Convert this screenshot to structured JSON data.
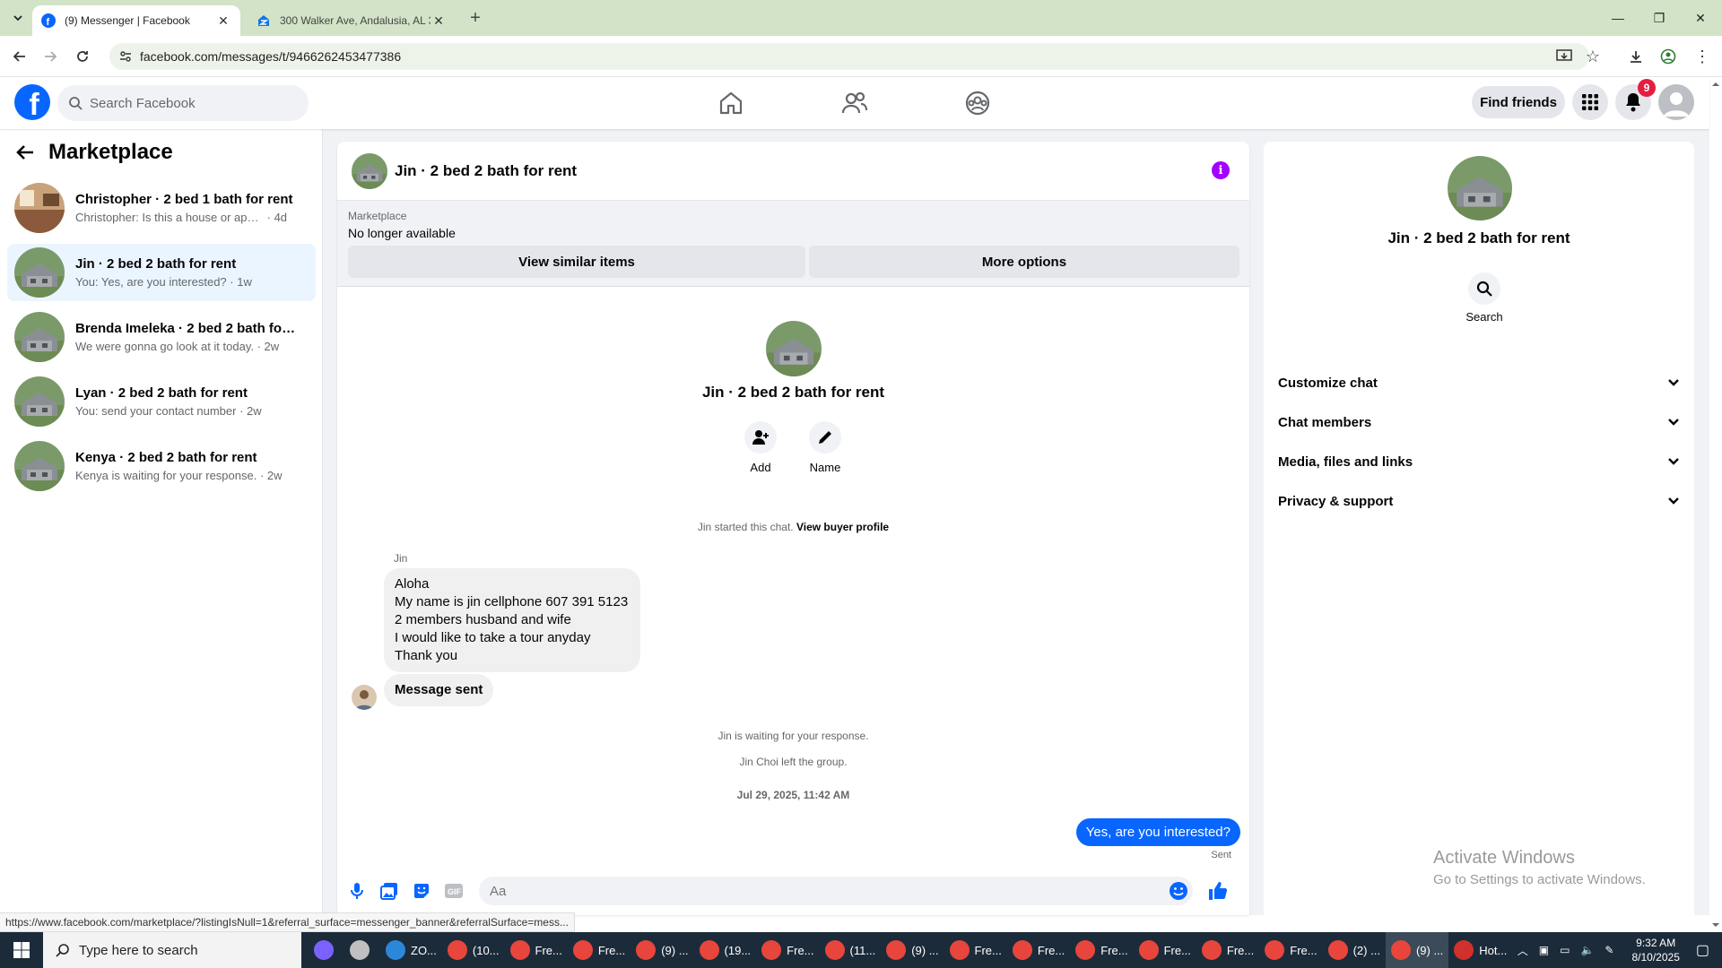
{
  "browser": {
    "tabs": [
      {
        "title": "(9) Messenger | Facebook",
        "active": true
      },
      {
        "title": "300 Walker Ave, Andalusia, AL 3",
        "active": false
      }
    ],
    "url": "facebook.com/messages/t/9466262453477386",
    "status_url": "https://www.facebook.com/marketplace/?listingIsNull=1&referral_surface=messenger_banner&referralSurface=mess..."
  },
  "fb": {
    "search_placeholder": "Search Facebook",
    "find_friends": "Find friends",
    "notif_count": "9"
  },
  "left": {
    "title": "Marketplace",
    "conversations": [
      {
        "title": "Christopher · 2 bed 1 bath for rent",
        "preview": "Christopher: Is this a house or apartm...",
        "time": "4d",
        "selected": false
      },
      {
        "title": "Jin · 2 bed 2 bath for rent",
        "preview": "You: Yes, are you interested?",
        "time": "1w",
        "selected": true
      },
      {
        "title": "Brenda Imeleka · 2 bed 2 bath for ...",
        "preview": "We were gonna go look at it today.",
        "time": "2w",
        "selected": false
      },
      {
        "title": "Lyan · 2 bed 2 bath for rent",
        "preview": "You: send your contact number",
        "time": "2w",
        "selected": false
      },
      {
        "title": "Kenya · 2 bed 2 bath for rent",
        "preview": "Kenya is waiting for your response.",
        "time": "2w",
        "selected": false
      }
    ]
  },
  "chat": {
    "title": "Jin · 2 bed 2 bath for rent",
    "banner": {
      "label": "Marketplace",
      "status": "No longer available",
      "btn_similar": "View similar items",
      "btn_more": "More options"
    },
    "profile_name": "Jin · 2 bed 2 bath for rent",
    "add_label": "Add",
    "name_label": "Name",
    "started_text": "Jin started this chat.",
    "view_buyer": "View buyer profile",
    "sender_name": "Jin",
    "incoming_lines": [
      "Aloha",
      "My name is jin cellphone 607 391 5123",
      "2 members husband and wife",
      "I would like to take a tour anyday",
      "Thank you"
    ],
    "message_sent": "Message sent",
    "waiting": "Jin is waiting for your response.",
    "left_group": "Jin Choi left the group.",
    "timestamp": "Jul 29, 2025, 11:42 AM",
    "my_message": "Yes, are you interested?",
    "sent_label": "Sent",
    "input_placeholder": "Aa"
  },
  "right": {
    "name": "Jin · 2 bed 2 bath for rent",
    "search_label": "Search",
    "sections": [
      "Customize chat",
      "Chat members",
      "Media, files and links",
      "Privacy & support"
    ]
  },
  "watermark": {
    "line1": "Activate Windows",
    "line2": "Go to Settings to activate Windows."
  },
  "taskbar": {
    "search_placeholder": "Type here to search",
    "apps": [
      {
        "label": "",
        "color": "#7b61ff"
      },
      {
        "label": "",
        "color": "#c0c0c0"
      },
      {
        "label": "ZO...",
        "color": "#2b88d8"
      },
      {
        "label": "(10...",
        "color": "#e8453c"
      },
      {
        "label": "Fre...",
        "color": "#e8453c"
      },
      {
        "label": "Fre...",
        "color": "#e8453c"
      },
      {
        "label": "(9) ...",
        "color": "#e8453c"
      },
      {
        "label": "(19...",
        "color": "#e8453c"
      },
      {
        "label": "Fre...",
        "color": "#e8453c"
      },
      {
        "label": "(11...",
        "color": "#e8453c"
      },
      {
        "label": "(9) ...",
        "color": "#e8453c"
      },
      {
        "label": "Fre...",
        "color": "#e8453c"
      },
      {
        "label": "Fre...",
        "color": "#e8453c"
      },
      {
        "label": "Fre...",
        "color": "#e8453c"
      },
      {
        "label": "Fre...",
        "color": "#e8453c"
      },
      {
        "label": "Fre...",
        "color": "#e8453c"
      },
      {
        "label": "Fre...",
        "color": "#e8453c"
      },
      {
        "label": "(2) ...",
        "color": "#e8453c"
      },
      {
        "label": "(9) ...",
        "color": "#e8453c"
      },
      {
        "label": "Hot...",
        "color": "#d0312d"
      }
    ],
    "time": "9:32 AM",
    "date": "8/10/2025"
  },
  "colors": {
    "fb_blue": "#0866ff",
    "selected_bg": "#ebf5ff",
    "info_purple": "#a200ff"
  }
}
